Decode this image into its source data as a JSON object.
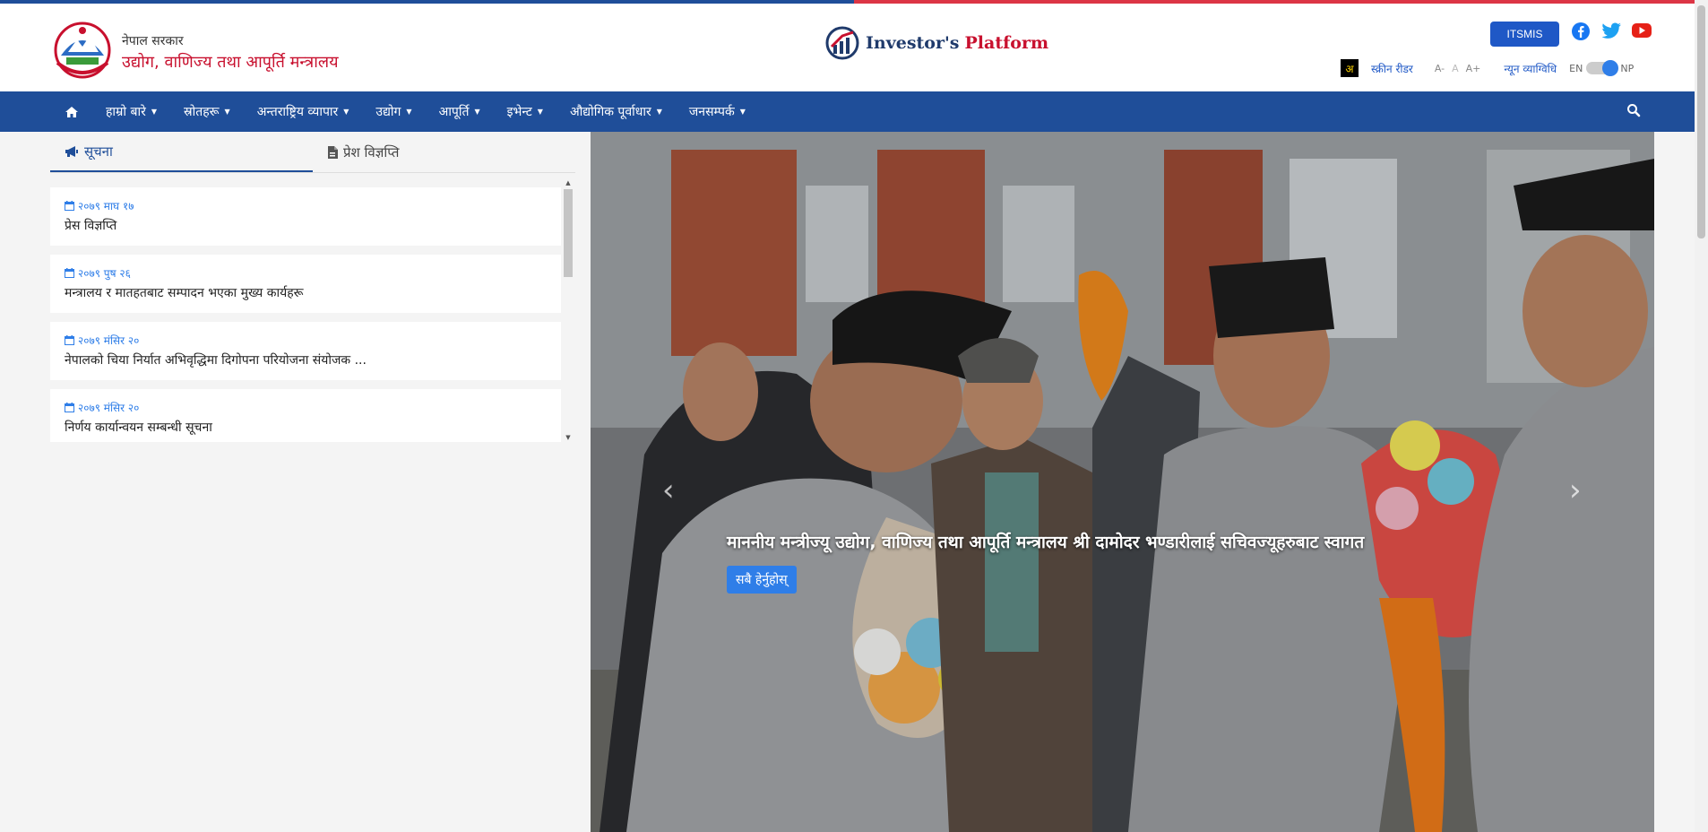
{
  "header": {
    "gov_line1": "नेपाल सरकार",
    "gov_line2": "उद्योग, वाणिज्य तथा आपूर्ति मन्त्रालय",
    "investor_prefix": "Investor's",
    "investor_suffix": "Platform",
    "itsmis_label": "ITSMIS",
    "social_icons": [
      "facebook-icon",
      "twitter-icon",
      "youtube-icon"
    ]
  },
  "tools": {
    "akshar": "अ",
    "screen_reader": "स्क्रीन रीडर",
    "font_decrease": "A-",
    "font_normal": "A",
    "font_increase": "A+",
    "low_vision": "न्यून व्याग्विधि",
    "lang_en": "EN",
    "lang_np": "NP"
  },
  "nav": {
    "items": [
      {
        "label": "हाम्रो बारे"
      },
      {
        "label": "स्रोतहरू"
      },
      {
        "label": "अन्तराष्ट्रिय व्यापार"
      },
      {
        "label": "उद्योग"
      },
      {
        "label": "आपूर्ति"
      },
      {
        "label": "इभेन्ट"
      },
      {
        "label": "औद्योगिक पूर्वाधार"
      },
      {
        "label": "जनसम्पर्क"
      }
    ]
  },
  "notices": {
    "tab_notice": "सूचना",
    "tab_press": "प्रेश विज्ञप्ति",
    "items": [
      {
        "date": "२०७९ माघ १७",
        "title": "प्रेस विज्ञप्ति"
      },
      {
        "date": "२०७९ पुष २६",
        "title": "मन्त्रालय र मातहतबाट सम्पादन भएका मुख्य कार्यहरू"
      },
      {
        "date": "२०७९ मंसिर २०",
        "title": "नेपालको चिया निर्यात अभिवृद्धिमा दिगोपना परियोजना संयोजक ..."
      },
      {
        "date": "२०७९ मंसिर २०",
        "title": "निर्णय कार्यान्वयन सम्बन्धी सूचना"
      }
    ]
  },
  "slider": {
    "caption": "माननीय मन्त्रीज्यू उद्योग, वाणिज्य तथा आपूर्ति मन्त्रालय श्री दामोदर भण्डारीलाई सचिवज्यूहरुबाट स्वागत",
    "view_all": "सबै हेर्नुहोस्"
  },
  "colors": {
    "brand_blue": "#1f4e99",
    "accent_red": "#c8102e",
    "link_blue": "#2f7ee8"
  }
}
